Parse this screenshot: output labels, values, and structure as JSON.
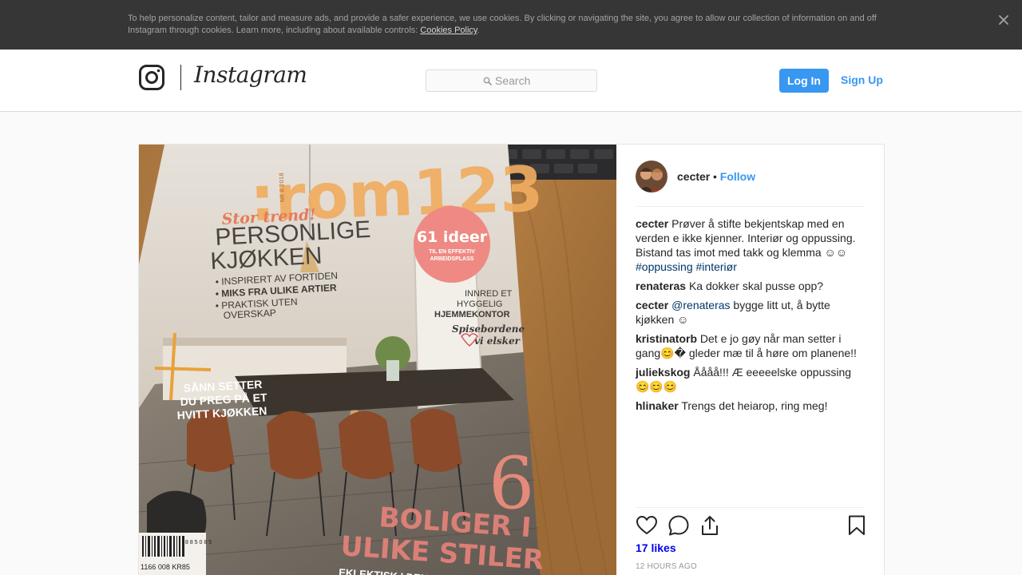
{
  "cookie_banner": {
    "text": "To help personalize content, tailor and measure ads, and provide a safer experience, we use cookies. By clicking or navigating the site, you agree to allow our collection of information on and off Instagram through cookies. Learn more, including about available controls: ",
    "link_label": "Cookies Policy",
    "suffix": "."
  },
  "header": {
    "brand": "Instagram",
    "search_placeholder": "Search",
    "login_label": "Log In",
    "signup_label": "Sign Up"
  },
  "post": {
    "author": "cecter",
    "separator": "•",
    "follow_label": "Follow",
    "caption": {
      "user": "cecter",
      "text": "Prøver å stifte bekjentskap med en verden e ikke kjenner. Interiør og oppussing. Bistand tas imot med takk og klemma ☺☺",
      "tags": [
        "#oppussing",
        "#interiør"
      ]
    },
    "comments": [
      {
        "user": "renateras",
        "text": "Ka dokker skal pusse opp?"
      },
      {
        "user": "cecter",
        "mention": "@renateras",
        "text": "bygge litt ut, å bytte kjøkken ☺"
      },
      {
        "user": "kristinatorb",
        "text": "Det e jo gøy når man setter i gang😊� gleder mæ til å høre om planene!!"
      },
      {
        "user": "juliekskog",
        "text": "Åååå!!! Æ eeeeelske oppussing😊😊😊"
      },
      {
        "user": "hlinaker",
        "text": "Trengs det heiarop, ring meg!"
      }
    ],
    "likes": "17 likes",
    "time": "12 HOURS AGO"
  },
  "photo": {
    "magazine_title": ":rom123",
    "issue_label": "NR 8.2018",
    "tagline": "Stor trend!",
    "headline_1": "PERSONLIGE",
    "headline_2": "KJØKKEN",
    "bullets": [
      "• INSPIRERT AV FORTIDEN",
      "• MIKS FRA ULIKE ARTIER",
      "• PRAKTISK UTEN",
      "OVERSKAP"
    ],
    "badge_big": "61 ideer",
    "badge_small_1": "TIL EN EFFEKTIV",
    "badge_small_2": "ARBEIDSPLASS",
    "office_1": "INNRED ET",
    "office_2": "HYGGELIG",
    "office_3": "HJEMMEKONTOR",
    "dining_1": "Spisebordene",
    "dining_2": "vi elsker",
    "white_1": "SÅNN SETTER",
    "white_2": "DU PREG PÅ ET",
    "white_3": "HVITT KJØKKEN",
    "six": "6",
    "homes_1": "BOLIGER I",
    "homes_2": "ULIKE STILER",
    "homes_sub": "EKLEKTISK I DEN GAMLE FABRIKKEN",
    "barcode_1": "1166 008 KR85",
    "barcode_2": "8 8 5 0 8 5"
  },
  "colors": {
    "accent": "#3897f0",
    "banner_bg": "#363636",
    "hashtag": "#003569"
  }
}
